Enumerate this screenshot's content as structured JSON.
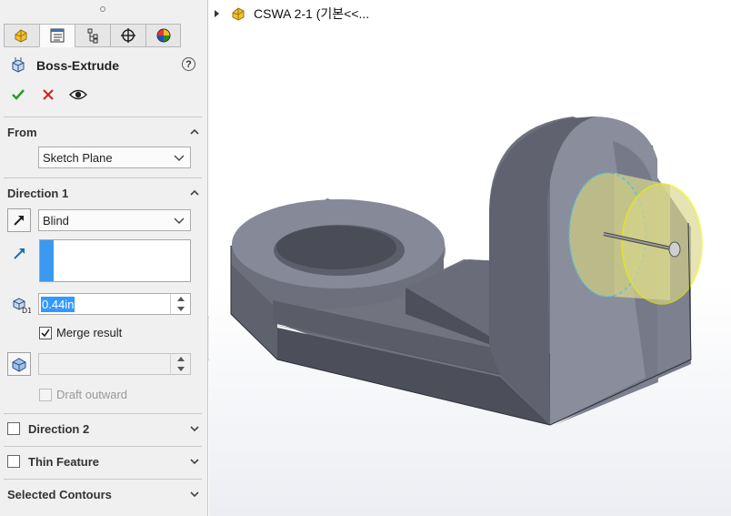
{
  "feature": {
    "title": "Boss-Extrude",
    "help_symbol": "?"
  },
  "tabs": [
    {
      "icon": "feature-manager-icon"
    },
    {
      "icon": "property-manager-icon"
    },
    {
      "icon": "configuration-manager-icon"
    },
    {
      "icon": "dimxpert-manager-icon"
    },
    {
      "icon": "display-manager-icon"
    }
  ],
  "from": {
    "label": "From",
    "value": "Sketch Plane"
  },
  "direction1": {
    "label": "Direction 1",
    "end_condition": "Blind",
    "depth": "0.44in",
    "merge_label": "Merge result",
    "merge_checked": true,
    "draft_label": "Draft outward",
    "draft_checked": false
  },
  "direction2": {
    "label": "Direction 2",
    "checked": false
  },
  "thin_feature": {
    "label": "Thin Feature",
    "checked": false
  },
  "selected_contours": {
    "label": "Selected Contours"
  },
  "tree": {
    "part_name": "CSWA 2-1  (기본<<..."
  },
  "colors": {
    "accept": "#2a9b2a",
    "cancel": "#d42020",
    "selection_bar": "#3c99f0",
    "preview_fill": "#d8d68a",
    "preview_edge": "#f0f000",
    "model_face": "#868a9a",
    "model_dark": "#4e505c"
  }
}
